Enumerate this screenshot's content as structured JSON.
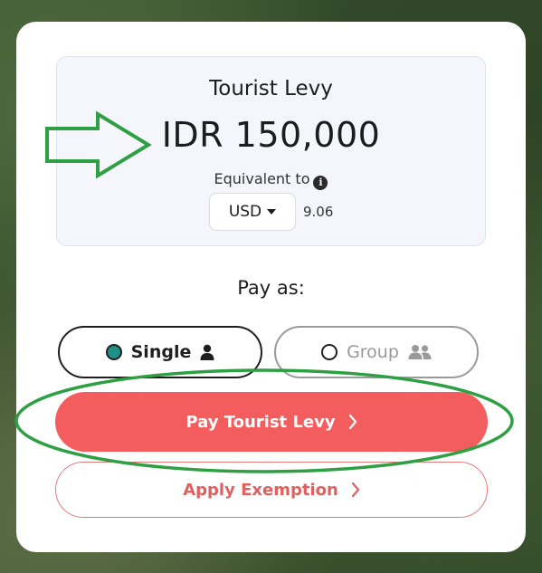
{
  "levy": {
    "title": "Tourist Levy",
    "amount": "IDR 150,000",
    "equivalent_label": "Equivalent to",
    "currency_selected": "USD",
    "converted_value": "9.06"
  },
  "pay_as": {
    "label": "Pay as:",
    "options": [
      {
        "label": "Single",
        "selected": true,
        "icon": "person-icon"
      },
      {
        "label": "Group",
        "selected": false,
        "icon": "group-icon"
      }
    ]
  },
  "actions": {
    "pay_label": "Pay Tourist Levy",
    "exemption_label": "Apply Exemption"
  },
  "colors": {
    "primary": "#f45d5d",
    "radio_selected": "#1f8f88",
    "annotation": "#2ea043"
  }
}
